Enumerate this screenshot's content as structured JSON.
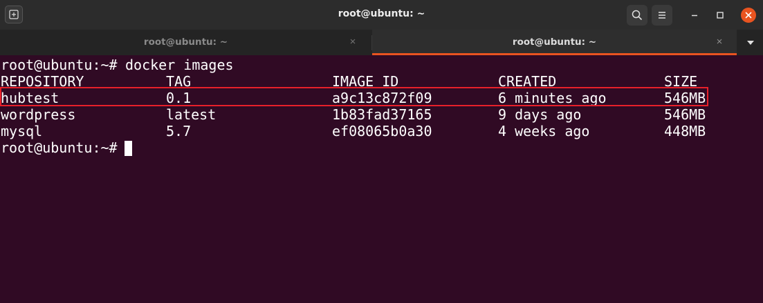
{
  "window": {
    "title": "root@ubuntu: ~"
  },
  "tabs": [
    {
      "label": "root@ubuntu: ~",
      "active": false
    },
    {
      "label": "root@ubuntu: ~",
      "active": true
    }
  ],
  "icons": {
    "new_tab": "new-tab-icon",
    "search": "search-icon",
    "menu": "hamburger-menu-icon",
    "minimize": "minimize-icon",
    "maximize": "maximize-icon",
    "close": "close-icon",
    "tab_close": "close-icon",
    "tabs_dropdown": "chevron-down-icon"
  },
  "colors": {
    "terminal_bg": "#300a24",
    "accent": "#e95420",
    "highlight_border": "#e8202a"
  },
  "terminal": {
    "prompt": "root@ubuntu:~# ",
    "command": "docker images",
    "headers": {
      "repository": "REPOSITORY",
      "tag": "TAG",
      "image_id": "IMAGE ID",
      "created": "CREATED",
      "size": "SIZE"
    },
    "rows": [
      {
        "repository": "hubtest",
        "tag": "0.1",
        "image_id": "a9c13c872f09",
        "created": "6 minutes ago",
        "size": "546MB",
        "highlighted": true
      },
      {
        "repository": "wordpress",
        "tag": "latest",
        "image_id": "1b83fad37165",
        "created": "9 days ago",
        "size": "546MB",
        "highlighted": false
      },
      {
        "repository": "mysql",
        "tag": "5.7",
        "image_id": "ef08065b0a30",
        "created": "4 weeks ago",
        "size": "448MB",
        "highlighted": false
      }
    ],
    "final_prompt": "root@ubuntu:~# "
  }
}
